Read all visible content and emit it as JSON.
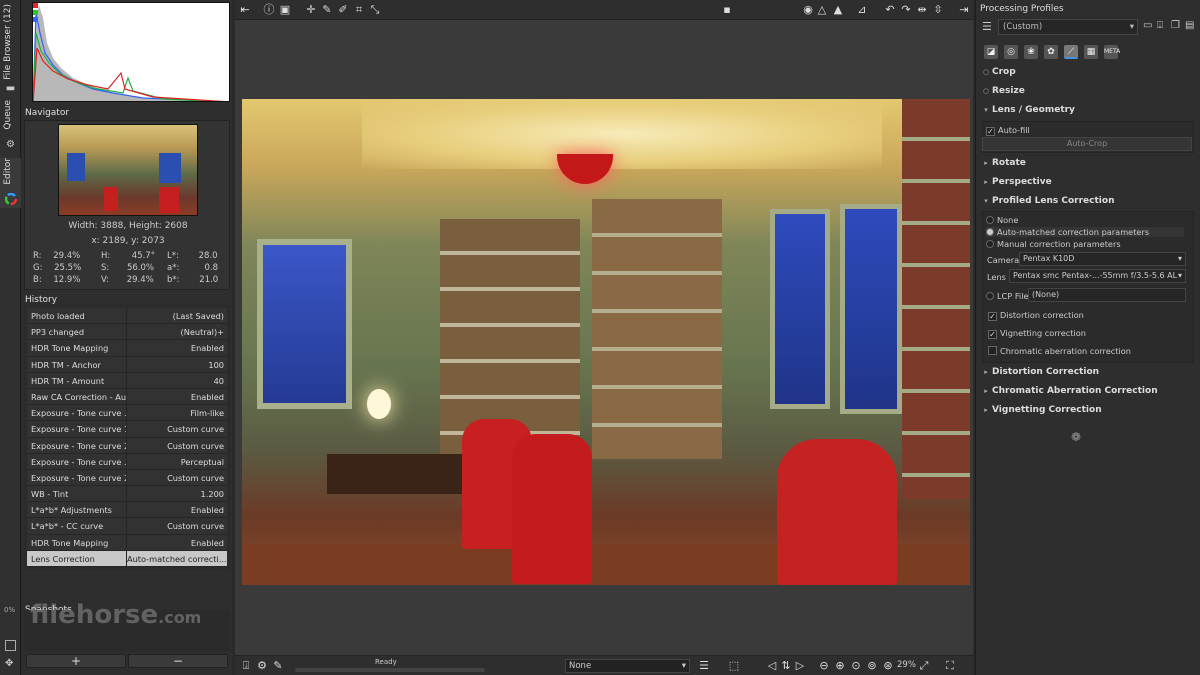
{
  "vertical_tabs": {
    "file_browser": "File Browser (12)",
    "queue": "Queue",
    "editor": "Editor"
  },
  "navigator": {
    "title": "Navigator",
    "size": "Width: 3888, Height: 2608",
    "xy": "x: 2189, y: 2073",
    "rgb": [
      {
        "k": "R:",
        "v": "29.4%"
      },
      {
        "k": "G:",
        "v": "25.5%"
      },
      {
        "k": "B:",
        "v": "12.9%"
      }
    ],
    "hsv": [
      {
        "k": "H:",
        "v": "45.7°"
      },
      {
        "k": "S:",
        "v": "56.0%"
      },
      {
        "k": "V:",
        "v": "29.4%"
      }
    ],
    "lab": [
      {
        "k": "L*:",
        "v": "28.0"
      },
      {
        "k": "a*:",
        "v": "0.8"
      },
      {
        "k": "b*:",
        "v": "21.0"
      }
    ]
  },
  "history": {
    "title": "History",
    "rows": [
      {
        "name": "Photo loaded",
        "value": "(Last Saved)"
      },
      {
        "name": "PP3 changed",
        "value": "(Neutral)+"
      },
      {
        "name": "HDR Tone Mapping",
        "value": "Enabled"
      },
      {
        "name": "HDR TM - Anchor",
        "value": "100"
      },
      {
        "name": "HDR TM - Amount",
        "value": "40"
      },
      {
        "name": "Raw CA Correction - Au...",
        "value": "Enabled"
      },
      {
        "name": "Exposure - Tone curve ...",
        "value": "Film-like"
      },
      {
        "name": "Exposure - Tone curve 1",
        "value": "Custom curve"
      },
      {
        "name": "Exposure - Tone curve 2",
        "value": "Custom curve"
      },
      {
        "name": "Exposure - Tone curve ...",
        "value": "Perceptual"
      },
      {
        "name": "Exposure - Tone curve 2",
        "value": "Custom curve"
      },
      {
        "name": "WB - Tint",
        "value": "1.200"
      },
      {
        "name": "L*a*b* Adjustments",
        "value": "Enabled"
      },
      {
        "name": "L*a*b* - CC curve",
        "value": "Custom curve"
      },
      {
        "name": "HDR Tone Mapping",
        "value": "Enabled"
      },
      {
        "name": "Lens Correction",
        "value": "Auto-matched correcti..."
      }
    ],
    "selected_index": 15
  },
  "snapshots": {
    "title": "Snapshots",
    "add": "+",
    "remove": "−"
  },
  "left_misc": {
    "zero_percent": "0%"
  },
  "bottom": {
    "status": "Ready",
    "profile": "None",
    "zoom": "29%"
  },
  "right": {
    "processing_profiles": "Processing Profiles",
    "profile_value": "(Custom)",
    "tools": {
      "crop": "Crop",
      "resize": "Resize",
      "lens_geometry": "Lens / Geometry",
      "auto_fill": "Auto-fill",
      "auto_crop": "Auto-Crop",
      "rotate": "Rotate",
      "perspective": "Perspective",
      "plc": "Profiled Lens Correction",
      "opt_none": "None",
      "opt_auto": "Auto-matched correction parameters",
      "opt_manual": "Manual correction parameters",
      "camera_label": "Camera",
      "camera_value": "Pentax K10D",
      "lens_label": "Lens",
      "lens_value": "Pentax smc Pentax-...-55mm f/3.5-5.6 AL",
      "lcp_label": "LCP File",
      "lcp_value": "(None)",
      "distortion_cb": "Distortion correction",
      "vignetting_cb": "Vignetting correction",
      "chromatic_cb": "Chromatic aberration correction",
      "distortion_correction": "Distortion Correction",
      "ca_correction": "Chromatic Aberration Correction",
      "vignetting_correction": "Vignetting Correction"
    },
    "tool_tab_meta": "META"
  },
  "watermark": {
    "main": "filehorse",
    "suffix": ".com"
  },
  "colors": {
    "accent_selected": "#c8c8c8",
    "panel_bg": "#2e2e2e"
  }
}
